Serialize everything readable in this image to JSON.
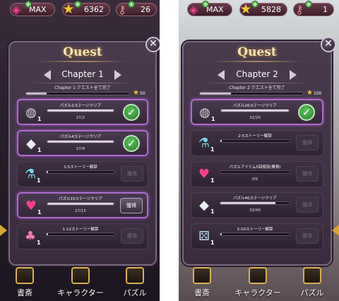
{
  "screens": [
    {
      "topbar": {
        "gems_label": "MAX",
        "gems_icon": "pink-gem-icon",
        "stars_value": "6362",
        "stars_icon": "star-icon",
        "keys_value": "26",
        "keys_icon": "key-icon"
      },
      "quest_title": "Quest",
      "close_label": "✕",
      "chapter": {
        "name": "Chapter 1",
        "subtitle": "Chapter 1 クエスト全て完了",
        "progress": 0.2,
        "reward": "50"
      },
      "items": [
        {
          "icon": "drum-icon",
          "glyph": "◍",
          "count": "1",
          "label": "パズル2ステージクリア",
          "progress_text": "27/2",
          "progress": 1.0,
          "status": "claimed",
          "button": "✓"
        },
        {
          "icon": "crystal-icon",
          "glyph": "◆",
          "count": "1",
          "label": "パズル4ステージクリア",
          "progress_text": "27/4",
          "progress": 1.0,
          "status": "claimed",
          "button": "✓"
        },
        {
          "icon": "potion-icon",
          "glyph": "⚗",
          "count": "1",
          "label": "1-5ストーリー解禁",
          "progress_text": "",
          "progress": 0.02,
          "status": "locked",
          "button": "獲得"
        },
        {
          "icon": "heart-gem-icon",
          "glyph": "♥",
          "count": "1",
          "label": "パズル15ステージクリア",
          "progress_text": "27/15",
          "progress": 1.0,
          "status": "ready",
          "button": "獲得"
        },
        {
          "icon": "clover-icon",
          "glyph": "♣",
          "count": "1",
          "label": "1-12ストーリー解禁",
          "progress_text": "",
          "progress": 0.02,
          "status": "locked",
          "button": "獲得"
        }
      ],
      "nav": [
        "書斎",
        "キャラクター",
        "パズル"
      ]
    },
    {
      "topbar": {
        "gems_label": "MAX",
        "gems_icon": "pink-gem-icon",
        "stars_value": "5828",
        "stars_icon": "star-icon",
        "keys_value": "1",
        "keys_icon": "key-icon"
      },
      "quest_title": "Quest",
      "close_label": "✕",
      "chapter": {
        "name": "Chapter 2",
        "subtitle": "Chapter 2 クエスト全て完了",
        "progress": 0.3,
        "reward": "100"
      },
      "items": [
        {
          "icon": "drum-icon",
          "glyph": "◍",
          "count": "1",
          "label": "パズル20ステージクリア",
          "progress_text": "32/20",
          "progress": 1.0,
          "status": "claimed",
          "button": "✓"
        },
        {
          "icon": "potion-icon",
          "glyph": "⚗",
          "count": "1",
          "label": "2-5ストーリー解禁",
          "progress_text": "",
          "progress": 0.02,
          "status": "locked",
          "button": "獲得"
        },
        {
          "icon": "heart-gem-icon",
          "glyph": "♥",
          "count": "1",
          "label": "パズルアイテム5回使用(累積)",
          "progress_text": "0/5",
          "progress": 0.0,
          "status": "locked",
          "button": "獲得"
        },
        {
          "icon": "crystal-icon",
          "glyph": "◆",
          "count": "1",
          "label": "パズル40ステージクリア",
          "progress_text": "32/40",
          "progress": 0.8,
          "status": "locked",
          "button": "獲得"
        },
        {
          "icon": "dice-icon",
          "glyph": "⚄",
          "count": "1",
          "label": "2-10ストーリー解禁",
          "progress_text": "",
          "progress": 0.02,
          "status": "locked",
          "button": "獲得"
        }
      ],
      "nav": [
        "書斎",
        "キャラクター",
        "パズル"
      ]
    }
  ],
  "colors": {
    "accent_purple": "#b06ad0",
    "claim_green": "#4fb84f",
    "star_gold": "#f2c830",
    "title_gold": "#f4e6b4"
  }
}
